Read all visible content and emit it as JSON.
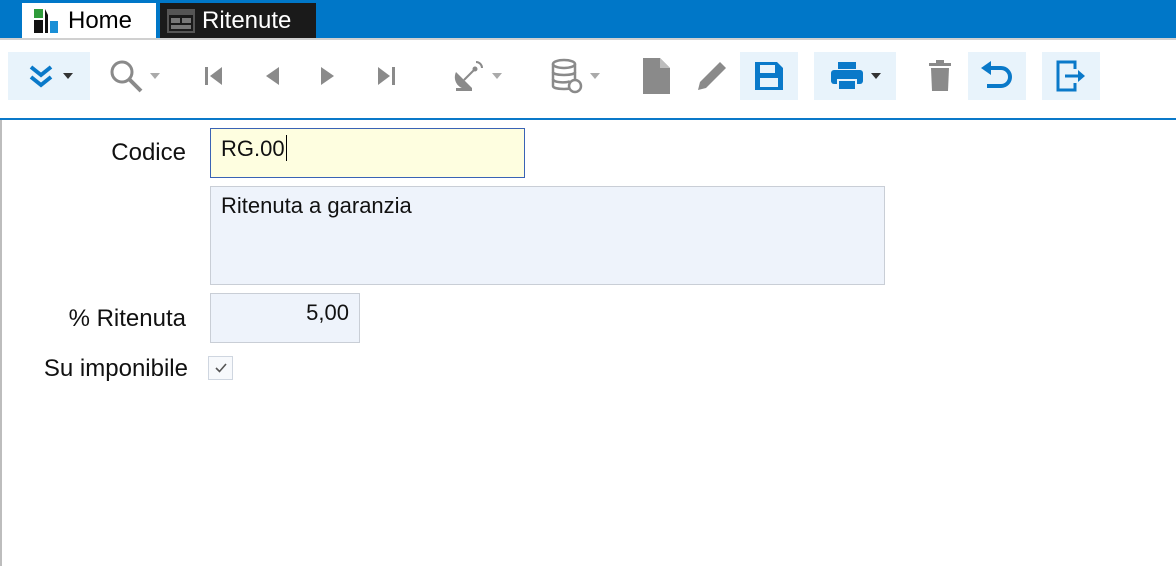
{
  "tabs": [
    {
      "label": "Home",
      "icon": "app-logo-icon"
    },
    {
      "label": "Ritenute",
      "icon": "form-window-icon"
    }
  ],
  "toolbar": {
    "buttons": [
      {
        "icon": "expand-chevrons-icon",
        "has_dropdown": true,
        "enabled": true
      },
      {
        "icon": "search-icon",
        "has_dropdown": true,
        "enabled": false
      },
      {
        "icon": "first-record-icon",
        "enabled": false
      },
      {
        "icon": "previous-record-icon",
        "enabled": false
      },
      {
        "icon": "next-record-icon",
        "enabled": false
      },
      {
        "icon": "last-record-icon",
        "enabled": false
      },
      {
        "icon": "satellite-dish-icon",
        "has_dropdown": true,
        "enabled": false
      },
      {
        "icon": "database-refresh-icon",
        "has_dropdown": true,
        "enabled": false
      },
      {
        "icon": "new-document-icon",
        "enabled": false
      },
      {
        "icon": "edit-pencil-icon",
        "enabled": false
      },
      {
        "icon": "save-icon",
        "enabled": true
      },
      {
        "icon": "print-icon",
        "has_dropdown": true,
        "enabled": true
      },
      {
        "icon": "delete-trash-icon",
        "enabled": false
      },
      {
        "icon": "undo-icon",
        "enabled": true
      },
      {
        "icon": "exit-icon",
        "enabled": true
      }
    ]
  },
  "form": {
    "codice_label": "Codice",
    "codice_value": "RG.00",
    "descrizione_value": "Ritenuta a garanzia",
    "ritenuta_label": "% Ritenuta",
    "ritenuta_value": "5,00",
    "su_imponibile_label": "Su imponibile",
    "su_imponibile_checked": true
  },
  "colors": {
    "tabbar": "#0077c8",
    "accent": "#0a79c9",
    "codice_bg": "#fefee0",
    "field_bg": "#eef3fb",
    "disabled_icon": "#8a8a8a"
  }
}
